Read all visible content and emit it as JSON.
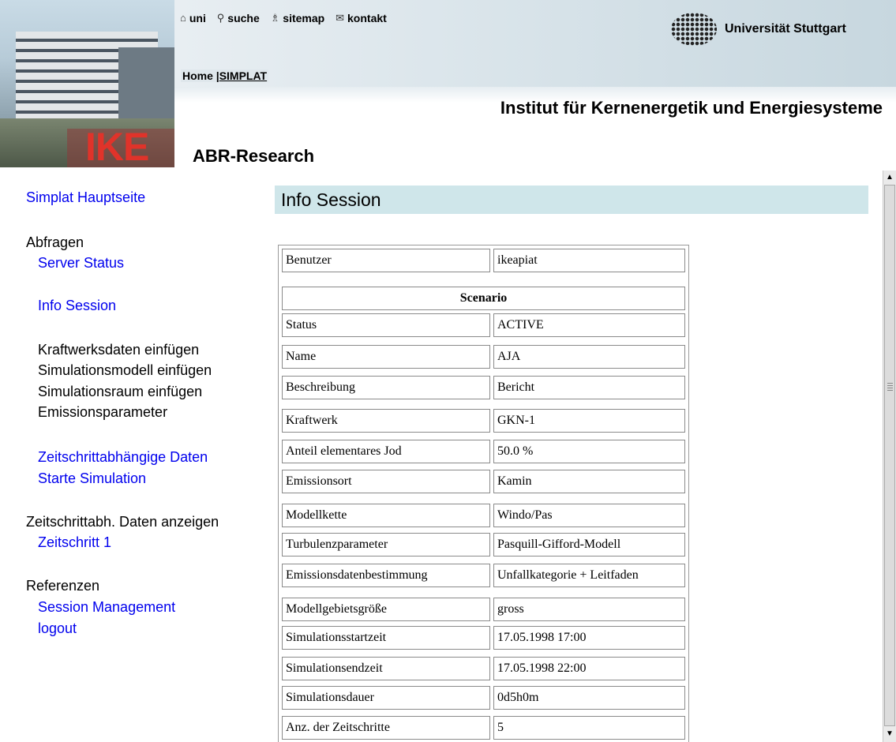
{
  "header": {
    "logo_text": "IKE",
    "university": "Universität Stuttgart",
    "institute": "Institut für Kernenergetik und Energiesysteme",
    "department": "ABR-Research",
    "topnav": [
      {
        "icon": "home-icon",
        "glyph": "⌂",
        "label": "uni"
      },
      {
        "icon": "search-icon",
        "glyph": "⚲",
        "label": "suche"
      },
      {
        "icon": "sitemap-icon",
        "glyph": "♗",
        "label": "sitemap"
      },
      {
        "icon": "mail-icon",
        "glyph": "✉",
        "label": "kontakt"
      }
    ],
    "breadcrumb": {
      "home": "Home |",
      "current": "SIMPLAT"
    }
  },
  "sidebar": {
    "hauptseite": "Simplat Hauptseite",
    "abfragen": "Abfragen",
    "server_status": "Server Status",
    "info_session": "Info Session",
    "kraftwerk": "Kraftwerksdaten einfügen",
    "simmodell": "Simulationsmodell einfügen",
    "simraum": "Simulationsraum einfügen",
    "emission": "Emissionsparameter",
    "zeitdaten": "Zeitschrittabhängige Daten",
    "starte": "Starte Simulation",
    "anzeigen": "Zeitschrittabh. Daten anzeigen",
    "zeitschritt1": "Zeitschritt 1",
    "referenzen": "Referenzen",
    "session_mgmt": "Session Management",
    "logout": "logout"
  },
  "main": {
    "title": "Info Session",
    "rows": [
      {
        "k": "Benutzer",
        "v": "ikeapiat"
      },
      {
        "header": "Scenario"
      },
      {
        "k": "Status",
        "v": "ACTIVE"
      },
      {
        "k": "Name",
        "v": "AJA"
      },
      {
        "k": "Beschreibung",
        "v": "Bericht"
      },
      {
        "k": "Kraftwerk",
        "v": "GKN-1"
      },
      {
        "k": "Anteil elementares Jod",
        "v": "50.0 %"
      },
      {
        "k": "Emissionsort",
        "v": "Kamin"
      },
      {
        "k": "Modellkette",
        "v": "Windo/Pas"
      },
      {
        "k": "Turbulenzparameter",
        "v": "Pasquill-Gifford-Modell"
      },
      {
        "k": "Emissionsdatenbestimmung",
        "v": "Unfallkategorie + Leitfaden"
      },
      {
        "k": "Modellgebietsgröße",
        "v": "gross"
      },
      {
        "k": "Simulationsstartzeit",
        "v": "17.05.1998 17:00"
      },
      {
        "k": "Simulationsendzeit",
        "v": "17.05.1998 22:00"
      },
      {
        "k": "Simulationsdauer",
        "v": "0d5h0m"
      },
      {
        "k": "Anz. der Zeitschritte",
        "v": "5"
      }
    ]
  }
}
